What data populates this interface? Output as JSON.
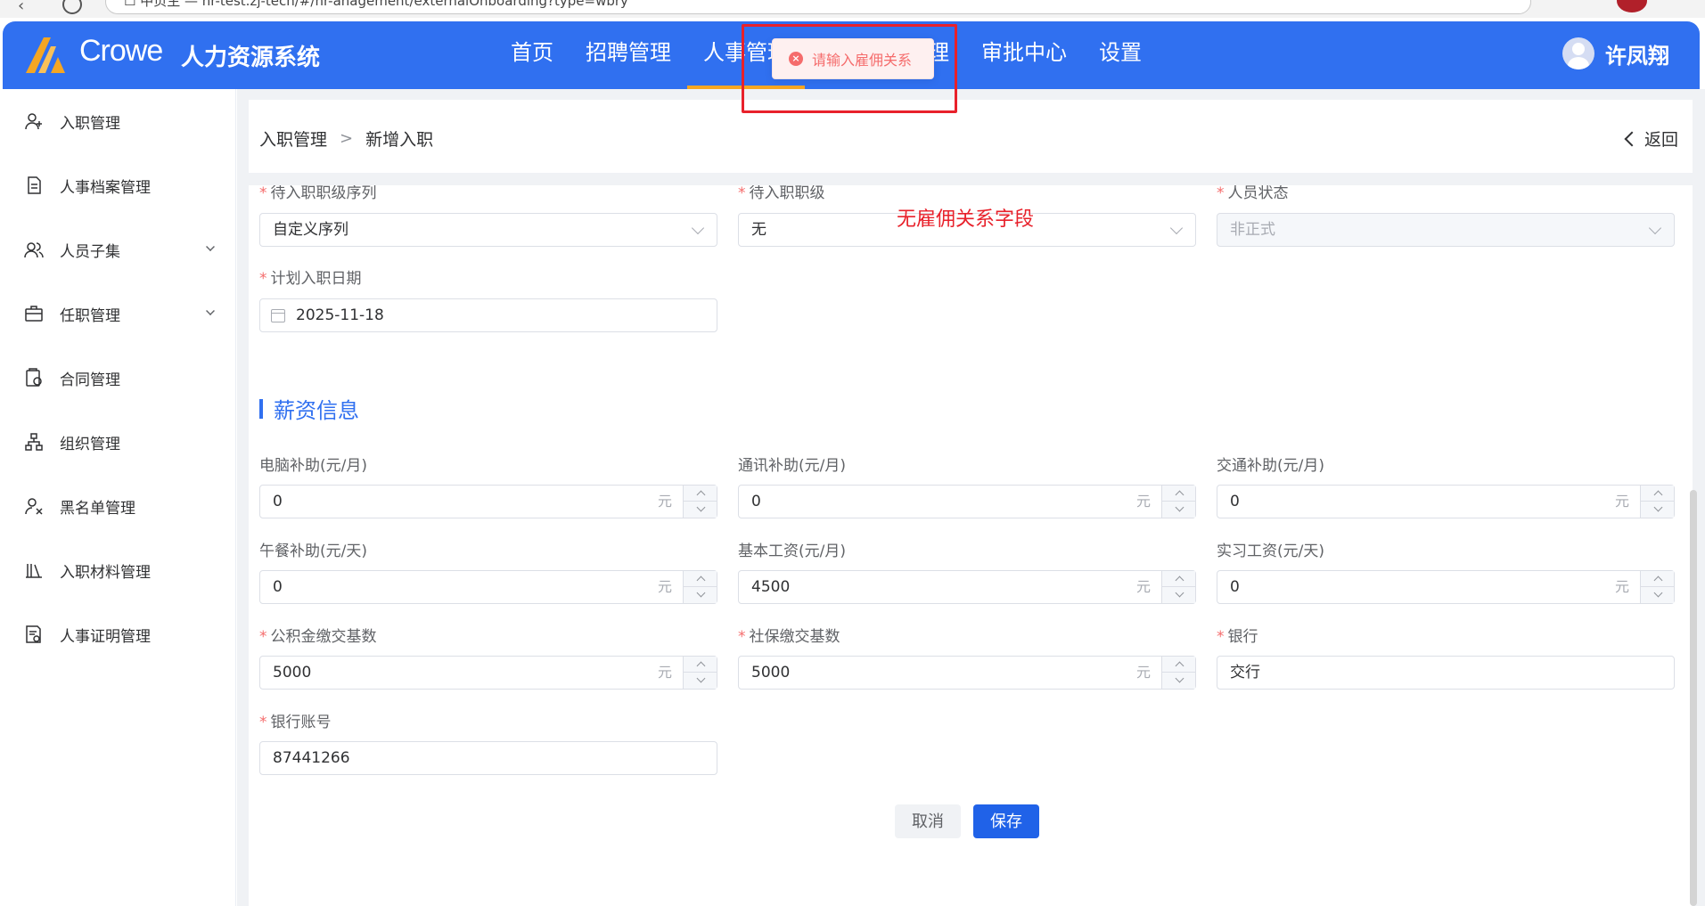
{
  "browser": {
    "url": "☐ 中页主 — hr-test.zj-tech/#/hr-anagement/externalOnboarding?type=wbry"
  },
  "header": {
    "brand": "Crowe",
    "system_name": "人力资源系统",
    "nav": [
      {
        "label": "首页"
      },
      {
        "label": "招聘管理"
      },
      {
        "label": "人事管理"
      },
      {
        "label": "薪酬福利管理"
      },
      {
        "label": "审批中心"
      },
      {
        "label": "设置"
      }
    ],
    "user_name": "许凤翔",
    "colors": {
      "primary": "#3070f0",
      "active_underline": "#f5a623"
    }
  },
  "toast": {
    "message": "请输入雇佣关系",
    "type": "error",
    "color": "#f56c6c"
  },
  "annotation": {
    "text": "无雇佣关系字段",
    "color": "#e8212b"
  },
  "sidebar": {
    "items": [
      {
        "label": "入职管理",
        "icon": "user-add-icon"
      },
      {
        "label": "人事档案管理",
        "icon": "document-icon"
      },
      {
        "label": "人员子集",
        "icon": "users-icon",
        "expandable": true
      },
      {
        "label": "任职管理",
        "icon": "briefcase-icon",
        "expandable": true
      },
      {
        "label": "合同管理",
        "icon": "contract-icon"
      },
      {
        "label": "组织管理",
        "icon": "org-chart-icon"
      },
      {
        "label": "黑名单管理",
        "icon": "user-block-icon"
      },
      {
        "label": "入职材料管理",
        "icon": "library-icon"
      },
      {
        "label": "人事证明管理",
        "icon": "certificate-icon"
      }
    ]
  },
  "breadcrumb": {
    "items": [
      "入职管理",
      "新增入职"
    ],
    "back_label": "返回"
  },
  "form": {
    "top_fields": [
      {
        "label": "待入职职级序列",
        "required": true,
        "value": "自定义序列",
        "type": "select"
      },
      {
        "label": "待入职职级",
        "required": true,
        "value": "无",
        "type": "select"
      },
      {
        "label": "人员状态",
        "required": true,
        "value": "非正式",
        "type": "select",
        "disabled": true
      }
    ],
    "planned_date": {
      "label": "计划入职日期",
      "required": true,
      "value": "2025-11-18"
    },
    "salary_section_title": "薪资信息",
    "salary_fields": [
      {
        "label": "电脑补助(元/月)",
        "value": "0",
        "unit": "元",
        "required": false
      },
      {
        "label": "通讯补助(元/月)",
        "value": "0",
        "unit": "元",
        "required": false
      },
      {
        "label": "交通补助(元/月)",
        "value": "0",
        "unit": "元",
        "required": false
      },
      {
        "label": "午餐补助(元/天)",
        "value": "0",
        "unit": "元",
        "required": false
      },
      {
        "label": "基本工资(元/月)",
        "value": "4500",
        "unit": "元",
        "required": false
      },
      {
        "label": "实习工资(元/天)",
        "value": "0",
        "unit": "元",
        "required": false
      },
      {
        "label": "公积金缴交基数",
        "value": "5000",
        "unit": "元",
        "required": true
      },
      {
        "label": "社保缴交基数",
        "value": "5000",
        "unit": "元",
        "required": true
      }
    ],
    "bank": {
      "label": "银行",
      "required": true,
      "value": "交行"
    },
    "bank_account": {
      "label": "银行账号",
      "required": true,
      "value": "87441266"
    },
    "cancel_label": "取消",
    "save_label": "保存"
  }
}
